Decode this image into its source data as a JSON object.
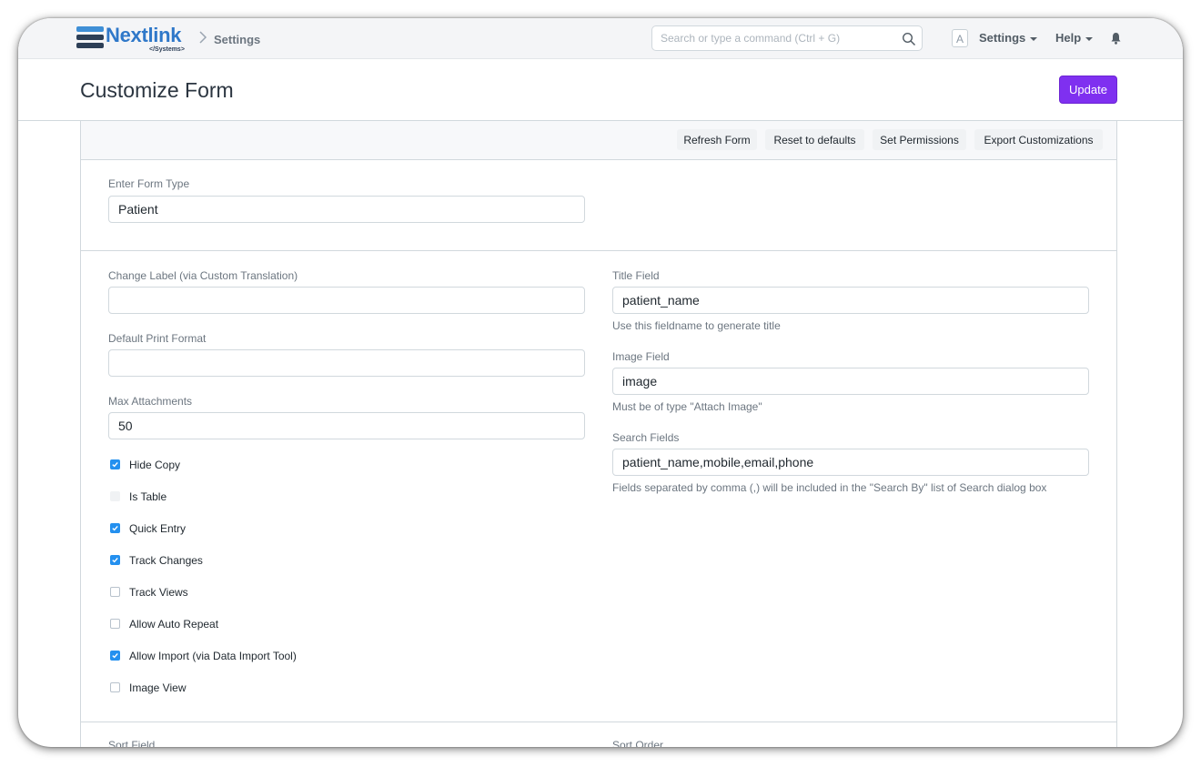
{
  "navbar": {
    "brand": "Nextlink",
    "brand_sub": "</Systems>",
    "breadcrumb": "Settings",
    "search_placeholder": "Search or type a command (Ctrl + G)",
    "avatar_letter": "A",
    "menu_settings": "Settings",
    "menu_help": "Help"
  },
  "page": {
    "title": "Customize Form",
    "update_label": "Update"
  },
  "toolbar": {
    "refresh": "Refresh Form",
    "reset": "Reset to defaults",
    "permissions": "Set Permissions",
    "export": "Export Customizations"
  },
  "form_type": {
    "label": "Enter Form Type",
    "value": "Patient"
  },
  "left": {
    "change_label": {
      "label": "Change Label (via Custom Translation)",
      "value": ""
    },
    "default_print_format": {
      "label": "Default Print Format",
      "value": ""
    },
    "max_attachments": {
      "label": "Max Attachments",
      "value": "50"
    },
    "checkboxes": [
      {
        "label": "Hide Copy",
        "checked": true
      },
      {
        "label": "Is Table",
        "checked": false,
        "disabled": true
      },
      {
        "label": "Quick Entry",
        "checked": true
      },
      {
        "label": "Track Changes",
        "checked": true
      },
      {
        "label": "Track Views",
        "checked": false
      },
      {
        "label": "Allow Auto Repeat",
        "checked": false
      },
      {
        "label": "Allow Import (via Data Import Tool)",
        "checked": true
      },
      {
        "label": "Image View",
        "checked": false
      }
    ]
  },
  "right": {
    "title_field": {
      "label": "Title Field",
      "value": "patient_name",
      "help": "Use this fieldname to generate title"
    },
    "image_field": {
      "label": "Image Field",
      "value": "image",
      "help": "Must be of type \"Attach Image\""
    },
    "search_fields": {
      "label": "Search Fields",
      "value": "patient_name,mobile,email,phone",
      "help": "Fields separated by comma (,) will be included in the \"Search By\" list of Search dialog box"
    }
  },
  "bottom": {
    "sort_field_label": "Sort Field",
    "sort_order_label": "Sort Order"
  },
  "colors": {
    "primary": "#7f30f0",
    "checkbox": "#2490ef",
    "brand": "#2f78c9"
  }
}
